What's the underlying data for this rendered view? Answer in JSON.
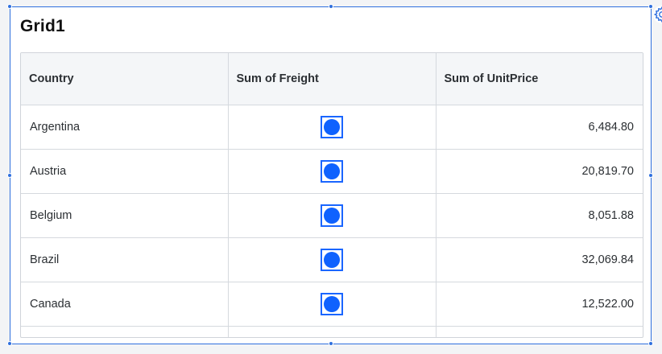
{
  "widget": {
    "title": "Grid1",
    "settings_icon": "gear-icon"
  },
  "grid": {
    "columns": [
      "Country",
      "Sum of Freight",
      "Sum of UnitPrice"
    ],
    "rows": [
      {
        "country": "Argentina",
        "freight_icon": "circle-marker-icon",
        "unit_price": "6,484.80"
      },
      {
        "country": "Austria",
        "freight_icon": "circle-marker-icon",
        "unit_price": "20,819.70"
      },
      {
        "country": "Belgium",
        "freight_icon": "circle-marker-icon",
        "unit_price": "8,051.88"
      },
      {
        "country": "Brazil",
        "freight_icon": "circle-marker-icon",
        "unit_price": "32,069.84"
      },
      {
        "country": "Canada",
        "freight_icon": "circle-marker-icon",
        "unit_price": "12,522.00"
      }
    ]
  },
  "colors": {
    "selection": "#2f6fde",
    "marker": "#0f62fe",
    "header_bg": "#f4f6f8",
    "border": "#d5d9de"
  }
}
